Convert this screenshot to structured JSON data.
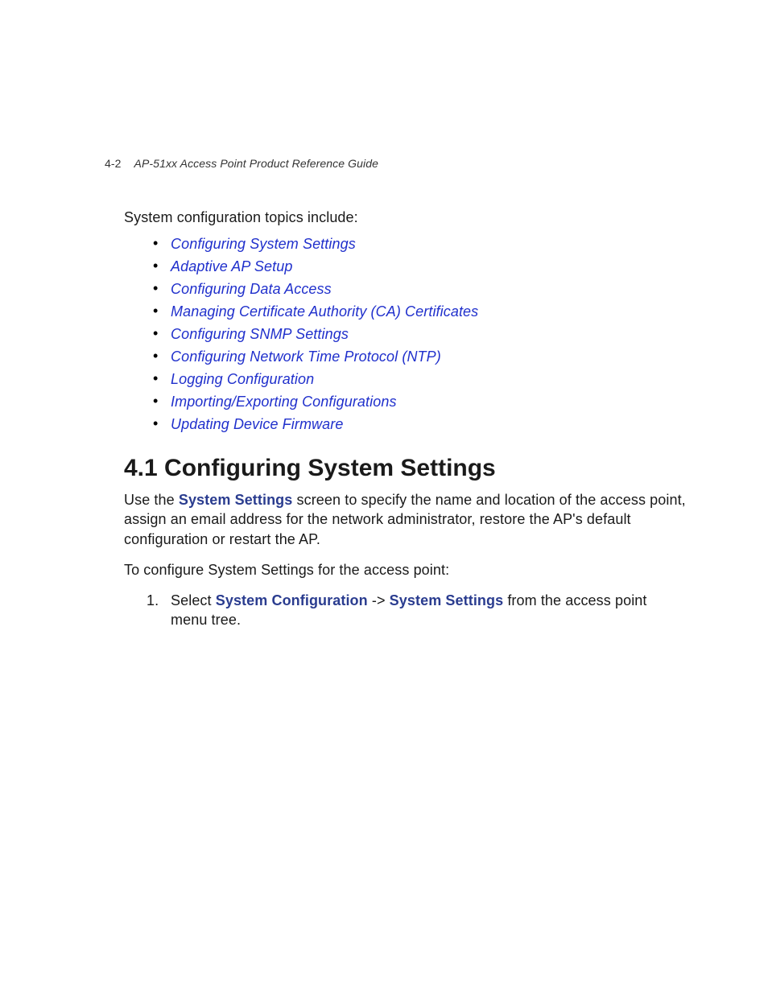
{
  "header": {
    "page_number": "4-2",
    "doc_title": "AP-51xx Access Point Product Reference Guide"
  },
  "intro": "System configuration topics include:",
  "toc_links": [
    "Configuring System Settings",
    "Adaptive AP Setup",
    "Configuring Data Access",
    "Managing Certificate Authority (CA) Certificates",
    "Configuring SNMP Settings",
    "Configuring Network Time Protocol (NTP)",
    "Logging Configuration",
    "Importing/Exporting Configurations",
    "Updating Device Firmware"
  ],
  "section": {
    "heading": "4.1 Configuring System Settings",
    "para1_pre": "Use the ",
    "para1_term": "System Settings",
    "para1_post": " screen to specify the name and location of the access point, assign an email address for the network administrator, restore the AP's default configuration or restart the AP.",
    "para2": "To configure System Settings for the access point:",
    "step1_pre": "Select ",
    "step1_term1": "System Configuration",
    "step1_mid": " -> ",
    "step1_term2": "System Settings",
    "step1_post": " from the access point menu tree."
  }
}
